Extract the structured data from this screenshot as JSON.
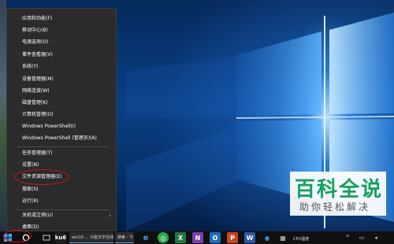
{
  "menu": {
    "items": [
      {
        "label": "应用和功能(F)",
        "submenu": false
      },
      {
        "label": "移动中心(B)",
        "submenu": false
      },
      {
        "label": "电源选项(O)",
        "submenu": false
      },
      {
        "label": "事件查看器(V)",
        "submenu": false
      },
      {
        "label": "系统(Y)",
        "submenu": false
      },
      {
        "label": "设备管理器(M)",
        "submenu": false
      },
      {
        "label": "网络连接(W)",
        "submenu": false
      },
      {
        "label": "磁盘管理(K)",
        "submenu": false
      },
      {
        "label": "计算机管理(G)",
        "submenu": false
      },
      {
        "label": "Windows PowerShell(I)",
        "submenu": false
      },
      {
        "label": "Windows PowerShell (管理员)(A)",
        "submenu": false
      },
      {
        "label": "任务管理器(T)",
        "submenu": false
      },
      {
        "label": "设置(N)",
        "submenu": false
      },
      {
        "label": "文件资源管理器(E)",
        "submenu": false
      },
      {
        "label": "搜索(S)",
        "submenu": false
      },
      {
        "label": "运行(R)",
        "submenu": false
      },
      {
        "label": "关机或注销(U)",
        "submenu": true
      },
      {
        "label": "桌面(D)",
        "submenu": false
      }
    ],
    "chevron": "›"
  },
  "taskbar": {
    "task1_label": "win10 ... 计能文字在线",
    "task2_label": "搜索 - 下",
    "cpu_label": "CPU温度",
    "icons": [
      "windows-start",
      "cortana",
      "task-view",
      "edge",
      "excel",
      "onenote",
      "outlook",
      "powerpoint",
      "word",
      "app"
    ]
  },
  "watermark": {
    "title": "百科全说",
    "subtitle": "助你轻松解决"
  },
  "colors": {
    "menu_bg": "#2b2b2b",
    "annotation": "#d0141b",
    "watermark_green": "#16a05d",
    "desktop_blue": "#0a3f86"
  }
}
